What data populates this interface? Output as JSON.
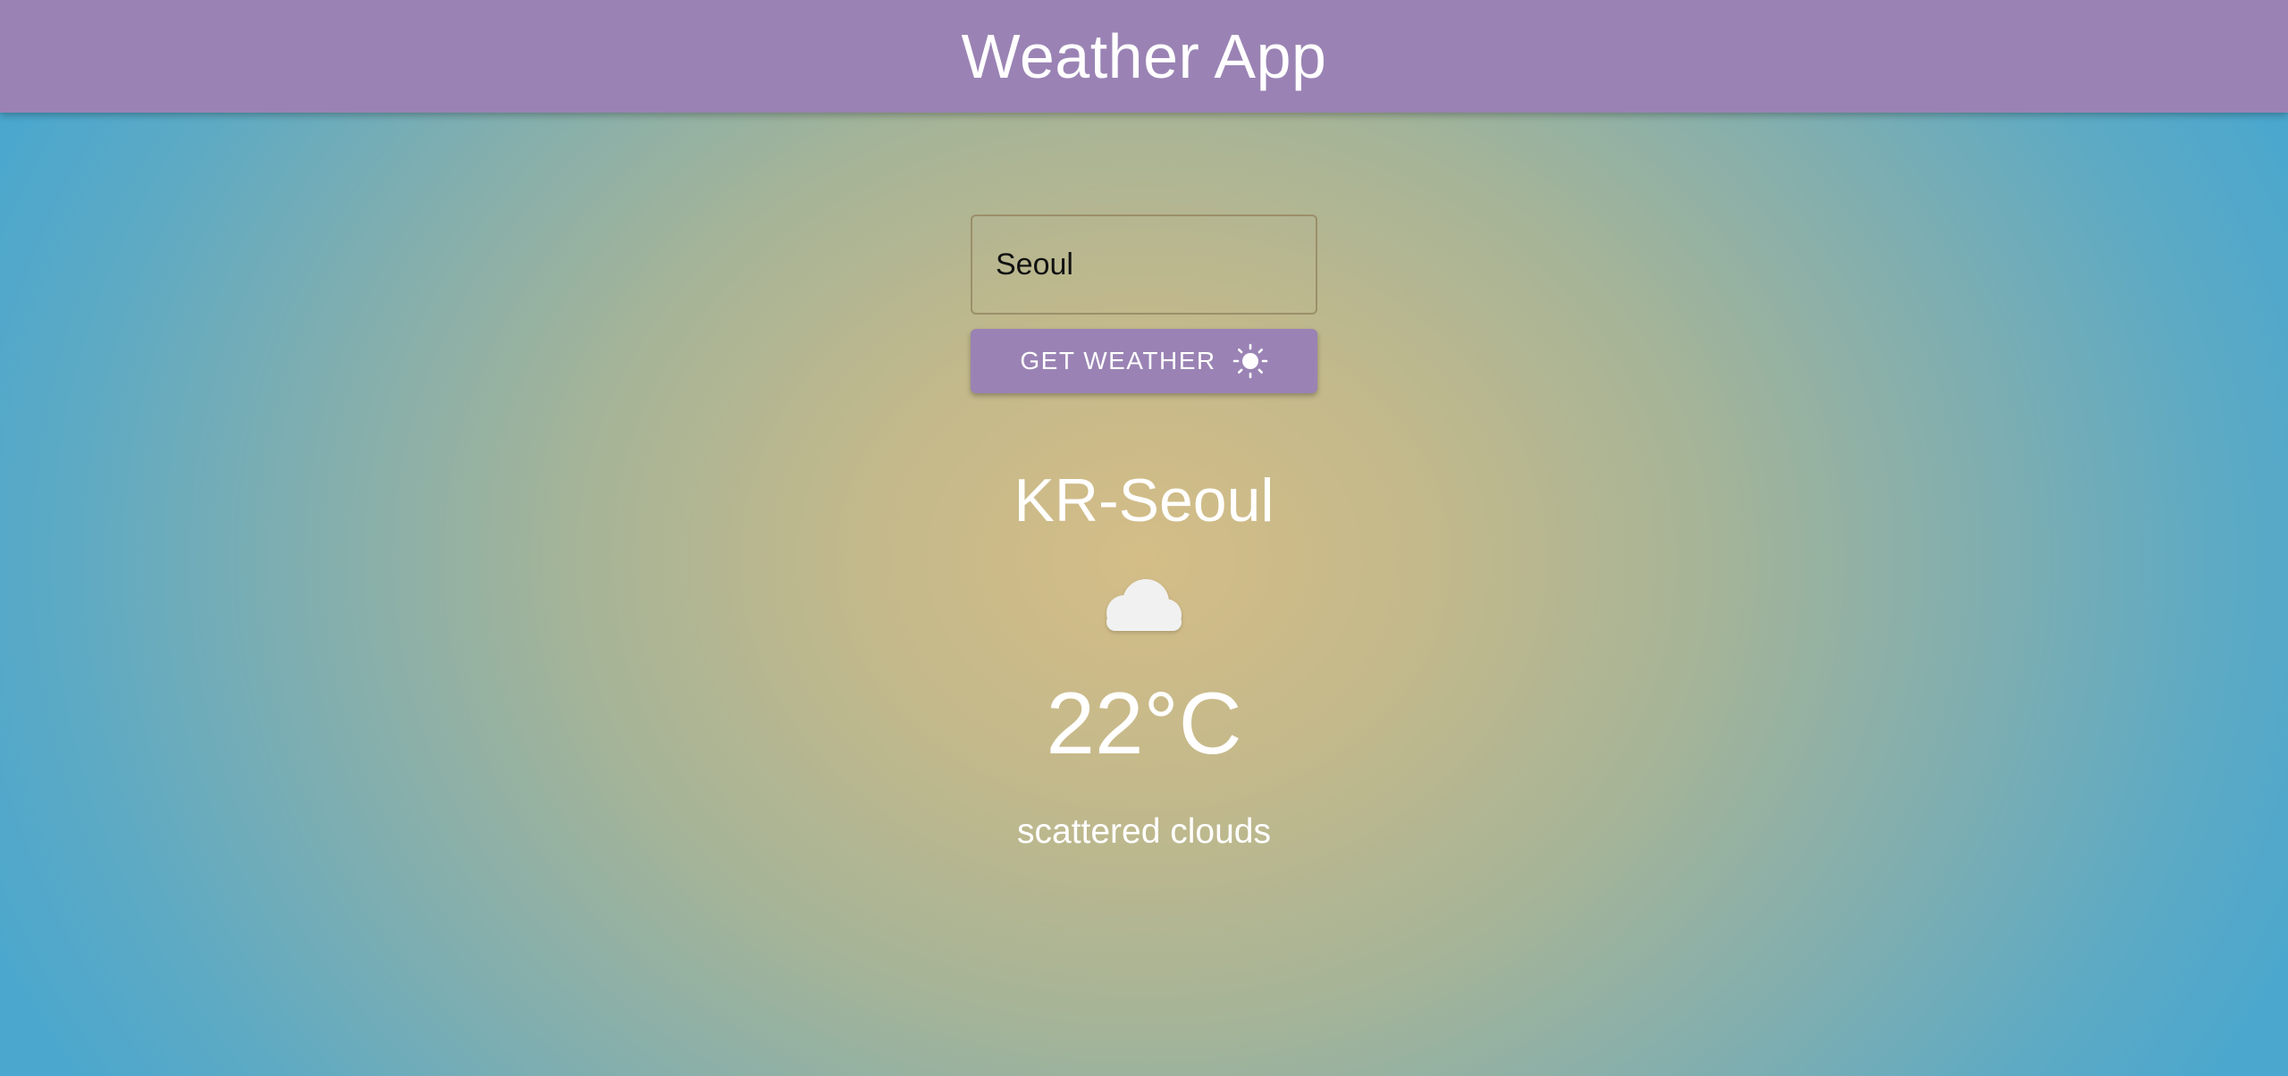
{
  "header": {
    "title": "Weather App",
    "background_color": "#9a83b4"
  },
  "search": {
    "value": "Seoul",
    "placeholder": ""
  },
  "button": {
    "label": "GET WEATHER",
    "icon": "sun-icon",
    "background_color": "#9a83b4"
  },
  "weather": {
    "location": "KR-Seoul",
    "icon": "cloud-icon",
    "temperature": "22°C",
    "description": "scattered clouds"
  }
}
